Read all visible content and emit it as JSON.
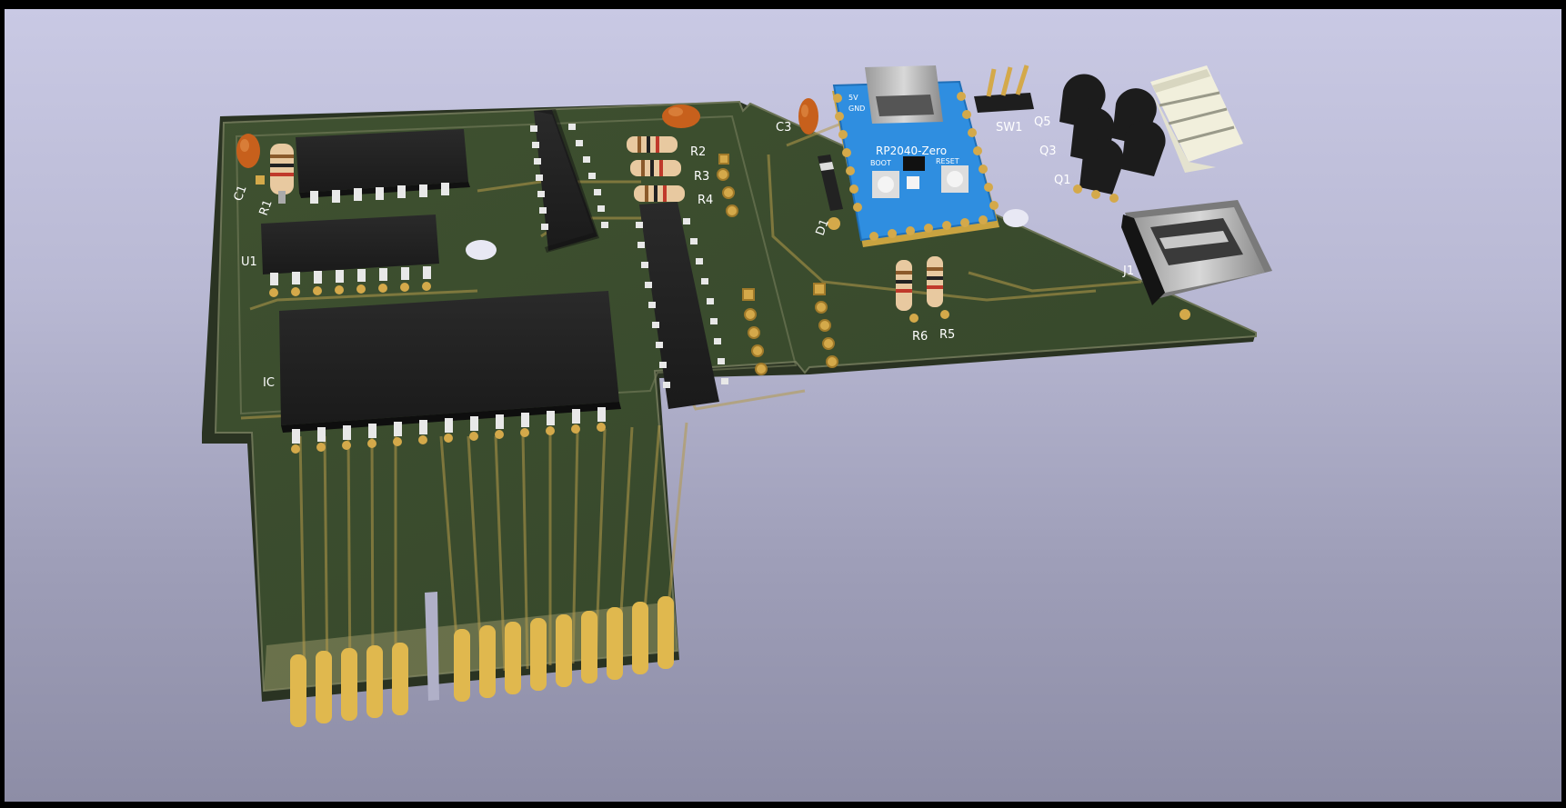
{
  "labels": {
    "c1": "C1",
    "r1": "R1",
    "u1": "U1",
    "ic": "IC",
    "r2": "R2",
    "r3": "R3",
    "r4": "R4",
    "c3": "C3",
    "d1": "D1",
    "r6": "R6",
    "r5": "R5",
    "sw1": "SW1",
    "q5": "Q5",
    "q3": "Q3",
    "q1": "Q1",
    "j1": "J1"
  },
  "module": {
    "name": "RP2040-Zero",
    "boot": "BOOT",
    "reset": "RESET",
    "pin_5v": "5V",
    "pin_gnd": "GND"
  },
  "colors": {
    "background_top": "#c9c9e4",
    "background_bottom": "#8d8da6",
    "pcb": "#3a4a2c",
    "copper": "#d4a94a",
    "module_blue": "#2f8ee0"
  }
}
